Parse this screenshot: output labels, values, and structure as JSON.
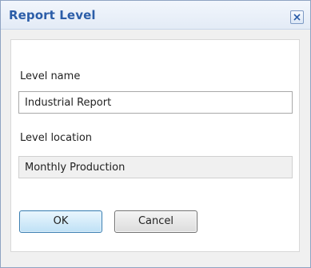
{
  "dialog": {
    "title": "Report Level",
    "close_icon": "close-icon",
    "level_name_label": "Level name",
    "level_name_value": "Industrial Report",
    "level_location_label": "Level location",
    "level_location_value": "Monthly Production",
    "ok_label": "OK",
    "cancel_label": "Cancel"
  },
  "colors": {
    "title_text": "#2b5da8",
    "close_x": "#2b5da8",
    "ok_border": "#3c7fb1"
  }
}
